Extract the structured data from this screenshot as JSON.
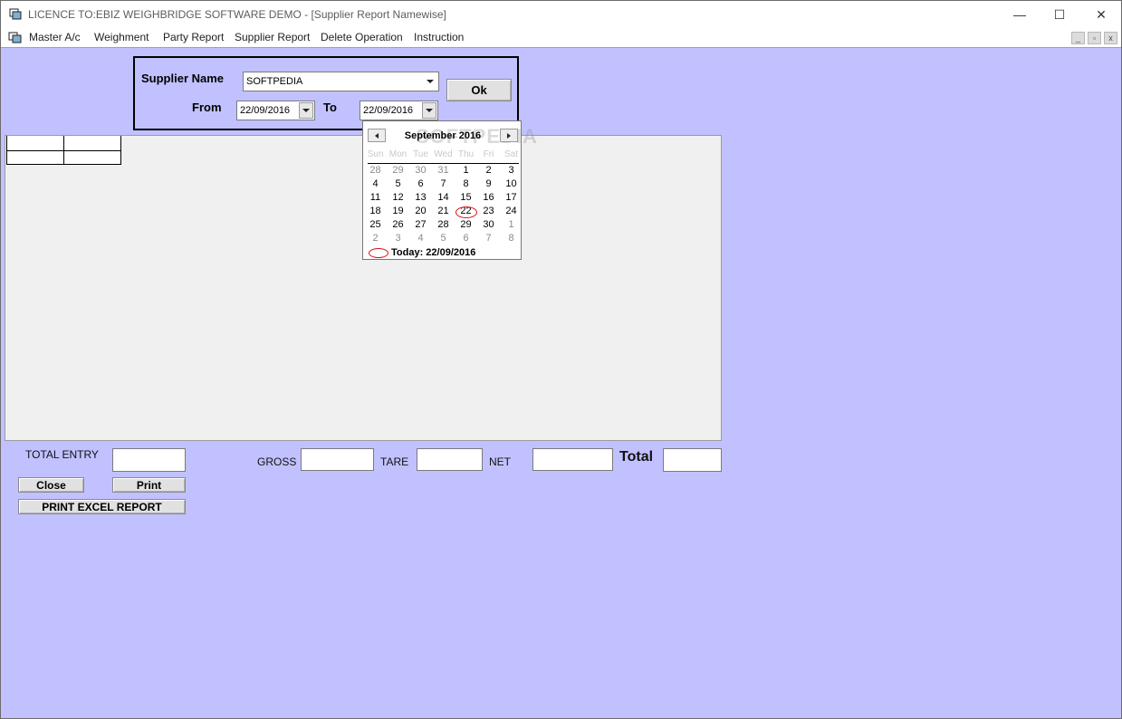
{
  "window": {
    "title": "LICENCE TO:EBIZ WEIGHBRIDGE SOFTWARE DEMO - [Supplier Report Namewise]",
    "controls": {
      "minimize": "—",
      "maximize": "☐",
      "close": "✕"
    }
  },
  "menu": {
    "items": [
      "Master A/c",
      "Weighment",
      "Party Report",
      "Supplier Report",
      "Delete Operation",
      "Instruction"
    ],
    "mdi_controls": [
      "_",
      "▫",
      "x"
    ]
  },
  "filter": {
    "supplier_label": "Supplier Name",
    "supplier_value": "SOFTPEDIA",
    "from_label": "From",
    "from_value": "22/09/2016",
    "to_label": "To",
    "to_value": "22/09/2016",
    "ok_label": "Ok"
  },
  "calendar": {
    "month_label": "September 2016",
    "watermark": "SOFTPEDIA",
    "day_headers": [
      "Sun",
      "Mon",
      "Tue",
      "Wed",
      "Thu",
      "Fri",
      "Sat"
    ],
    "weeks": [
      [
        "28",
        "29",
        "30",
        "31",
        "1",
        "2",
        "3"
      ],
      [
        "4",
        "5",
        "6",
        "7",
        "8",
        "9",
        "10"
      ],
      [
        "11",
        "12",
        "13",
        "14",
        "15",
        "16",
        "17"
      ],
      [
        "18",
        "19",
        "20",
        "21",
        "22",
        "23",
        "24"
      ],
      [
        "25",
        "26",
        "27",
        "28",
        "29",
        "30",
        "1"
      ],
      [
        "2",
        "3",
        "4",
        "5",
        "6",
        "7",
        "8"
      ]
    ],
    "selected_day": "22",
    "today_label": "Today: 22/09/2016"
  },
  "totals": {
    "total_entry_label": "TOTAL ENTRY",
    "gross_label": "GROSS",
    "tare_label": "TARE",
    "net_label": "NET",
    "total_label": "Total"
  },
  "buttons": {
    "close": "Close",
    "print": "Print",
    "print_excel": "PRINT EXCEL REPORT"
  }
}
